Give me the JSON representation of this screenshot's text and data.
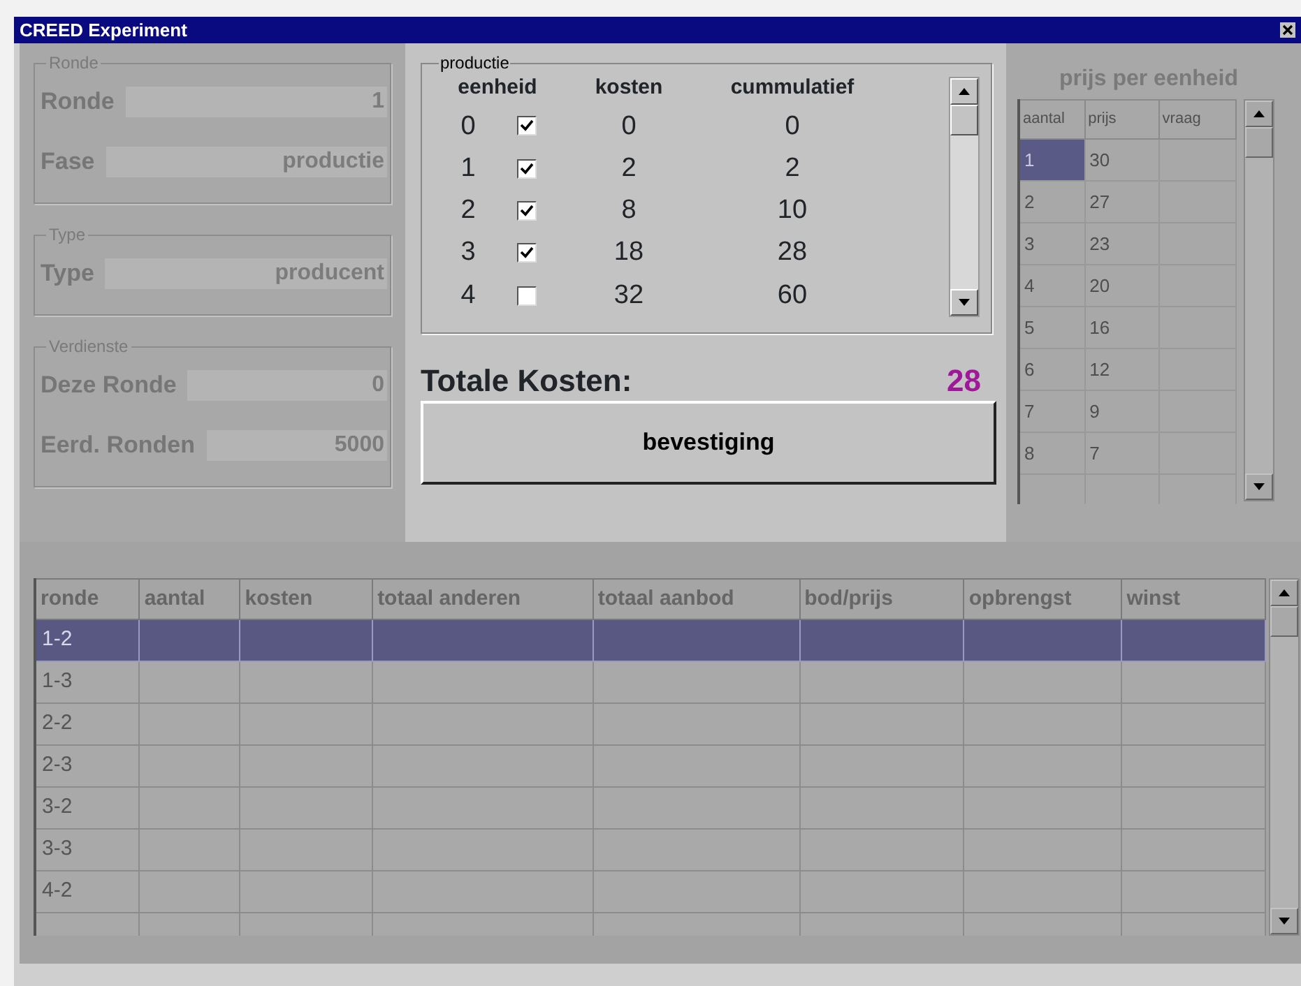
{
  "window": {
    "title": "CREED Experiment"
  },
  "left_groups": [
    {
      "legend": "Ronde",
      "disabled": true,
      "fields": [
        {
          "label": "Ronde",
          "value": "1"
        },
        {
          "label": "Fase",
          "value": "productie"
        }
      ]
    },
    {
      "legend": "Type",
      "disabled": true,
      "fields": [
        {
          "label": "Type",
          "value": "producent"
        }
      ]
    },
    {
      "legend": "Verdienste",
      "disabled": true,
      "fields": [
        {
          "label": "Deze Ronde",
          "value": "0"
        },
        {
          "label": "Eerd. Ronden",
          "value": "5000"
        }
      ]
    }
  ],
  "productie": {
    "legend": "productie",
    "columns": [
      "eenheid",
      "kosten",
      "cummulatief"
    ],
    "rows": [
      {
        "eenheid": "0",
        "checked": true,
        "kosten": "0",
        "cummulatief": "0"
      },
      {
        "eenheid": "1",
        "checked": true,
        "kosten": "2",
        "cummulatief": "2"
      },
      {
        "eenheid": "2",
        "checked": true,
        "kosten": "8",
        "cummulatief": "10"
      },
      {
        "eenheid": "3",
        "checked": true,
        "kosten": "18",
        "cummulatief": "28"
      },
      {
        "eenheid": "4",
        "checked": false,
        "kosten": "32",
        "cummulatief": "60"
      }
    ]
  },
  "totale_kosten": {
    "label": "Totale Kosten:",
    "value": "28"
  },
  "confirm_button": {
    "label": "bevestiging"
  },
  "price_table": {
    "title": "prijs per eenheid",
    "disabled": true,
    "columns": [
      "aantal",
      "prijs",
      "vraag"
    ],
    "rows": [
      {
        "aantal": "1",
        "prijs": "30",
        "selected": true
      },
      {
        "aantal": "2",
        "prijs": "27",
        "selected": false
      },
      {
        "aantal": "3",
        "prijs": "23",
        "selected": false
      },
      {
        "aantal": "4",
        "prijs": "20",
        "selected": false
      },
      {
        "aantal": "5",
        "prijs": "16",
        "selected": false
      },
      {
        "aantal": "6",
        "prijs": "12",
        "selected": false
      },
      {
        "aantal": "7",
        "prijs": "9",
        "selected": false
      },
      {
        "aantal": "8",
        "prijs": "7",
        "selected": false
      }
    ]
  },
  "results_table": {
    "disabled": true,
    "columns": [
      "ronde",
      "aantal",
      "kosten",
      "totaal anderen",
      "totaal aanbod",
      "bod/prijs",
      "opbrengst",
      "winst"
    ],
    "rows": [
      {
        "ronde": "1-2",
        "selected": true
      },
      {
        "ronde": "1-3",
        "selected": false
      },
      {
        "ronde": "2-2",
        "selected": false
      },
      {
        "ronde": "2-3",
        "selected": false
      },
      {
        "ronde": "3-2",
        "selected": false
      },
      {
        "ronde": "3-3",
        "selected": false
      },
      {
        "ronde": "4-2",
        "selected": false
      }
    ]
  }
}
